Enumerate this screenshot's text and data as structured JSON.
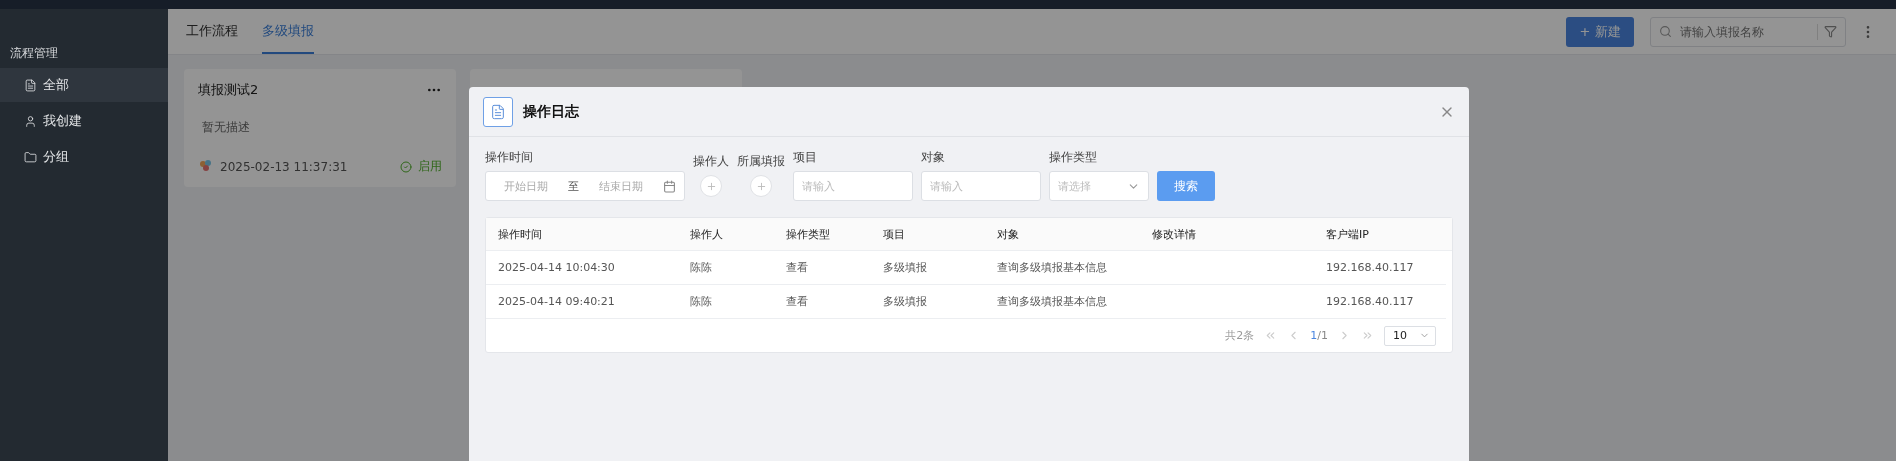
{
  "sidebar": {
    "section_title": "流程管理",
    "items": [
      {
        "label": "全部",
        "selected": true
      },
      {
        "label": "我创建",
        "selected": false
      },
      {
        "label": "分组",
        "selected": false
      }
    ]
  },
  "tabs": [
    {
      "label": "工作流程",
      "selected": false
    },
    {
      "label": "多级填报",
      "selected": true
    }
  ],
  "toolbar": {
    "new_button": "+ 新建",
    "search": {
      "placeholder": "请输入填报名称"
    }
  },
  "cards": [
    {
      "kind": "full",
      "title": "填报测试2",
      "description": "暂无描述",
      "date": "2025-02-13 11:37:31",
      "status": "启用"
    },
    {
      "kind": "covered"
    }
  ],
  "dialog": {
    "title": "操作日志",
    "filters": [
      {
        "kind": "daterange",
        "label": "操作时间",
        "start_placeholder": "开始日期",
        "separator": "至",
        "end_placeholder": "结束日期"
      },
      {
        "kind": "picker",
        "label": "操作人"
      },
      {
        "kind": "picker",
        "label": "所属填报"
      },
      {
        "kind": "input",
        "label": "项目",
        "placeholder": "请输入"
      },
      {
        "kind": "input",
        "label": "对象",
        "placeholder": "请输入"
      },
      {
        "kind": "select",
        "label": "操作类型",
        "placeholder": "请选择"
      }
    ],
    "search_button": "搜索",
    "table": {
      "columns": [
        "操作时间",
        "操作人",
        "操作类型",
        "项目",
        "对象",
        "修改详情",
        "客户端IP"
      ],
      "rows": [
        [
          "2025-04-14 10:04:30",
          "陈陈",
          "查看",
          "多级填报",
          "查询多级填报基本信息",
          "",
          "192.168.40.117"
        ],
        [
          "2025-04-14 09:40:21",
          "陈陈",
          "查看",
          "多级填报",
          "查询多级填报基本信息",
          "",
          "192.168.40.117"
        ]
      ]
    },
    "pagination": {
      "total": "共2条",
      "current": "1",
      "pages": "/1",
      "page_size": "10"
    }
  }
}
